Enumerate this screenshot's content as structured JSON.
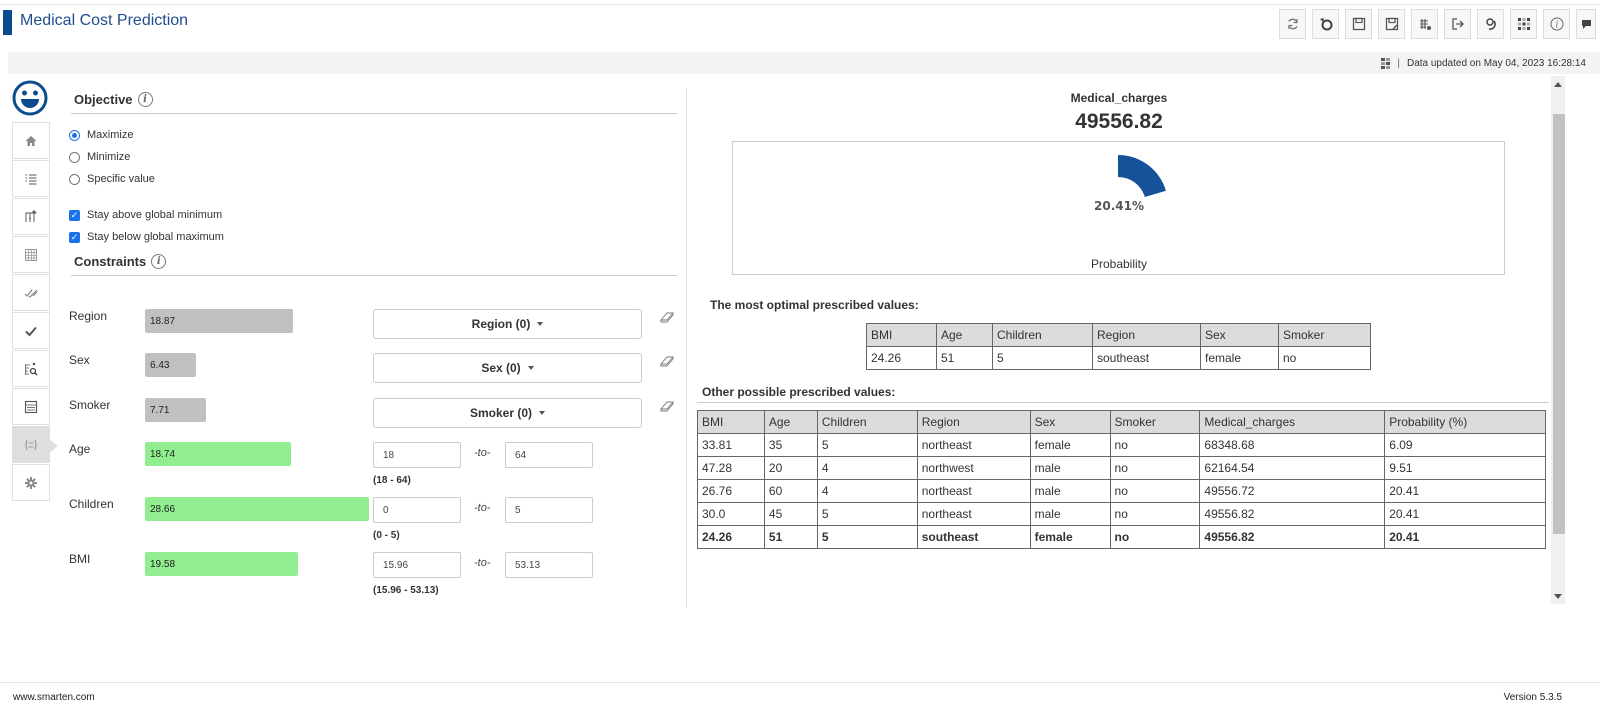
{
  "app": {
    "title": "Medical Cost Prediction"
  },
  "toolbar": {
    "buttons": [
      {
        "name": "refresh",
        "icon": "refresh-icon"
      },
      {
        "name": "reset",
        "icon": "reset-icon"
      },
      {
        "name": "save",
        "icon": "save-icon"
      },
      {
        "name": "save-as",
        "icon": "save-as-icon"
      },
      {
        "name": "data-settings",
        "icon": "data-settings-icon"
      },
      {
        "name": "export",
        "icon": "export-icon"
      },
      {
        "name": "auto-refresh",
        "icon": "auto-refresh-icon"
      },
      {
        "name": "layout",
        "icon": "grid-icon"
      },
      {
        "name": "info",
        "icon": "info-icon"
      },
      {
        "name": "comments",
        "icon": "comments-icon"
      }
    ]
  },
  "info_strip": {
    "separator": "|",
    "updated_text": "Data updated on May 04, 2023 16:28:14"
  },
  "sidebar": {
    "items": [
      {
        "name": "home",
        "icon": "home-icon"
      },
      {
        "name": "list",
        "icon": "list-icon"
      },
      {
        "name": "variables",
        "icon": "variables-icon"
      },
      {
        "name": "table",
        "icon": "table-icon"
      },
      {
        "name": "double-check",
        "icon": "double-check-icon"
      },
      {
        "name": "check",
        "icon": "check-icon"
      },
      {
        "name": "search-data",
        "icon": "search-data-icon"
      },
      {
        "name": "summary",
        "icon": "summary-icon"
      },
      {
        "name": "prescriptive",
        "icon": "prescriptive-icon",
        "active": true
      },
      {
        "name": "settings",
        "icon": "gear-icon"
      }
    ]
  },
  "objective": {
    "title": "Objective",
    "info_glyph": "i",
    "options": [
      {
        "label": "Maximize",
        "selected": true
      },
      {
        "label": "Minimize",
        "selected": false
      },
      {
        "label": "Specific value",
        "selected": false
      }
    ],
    "checks": [
      {
        "label": "Stay above global minimum",
        "checked": true
      },
      {
        "label": "Stay below global maximum",
        "checked": true
      }
    ]
  },
  "constraints": {
    "title": "Constraints",
    "info_glyph": "i",
    "categorical": [
      {
        "label": "Region",
        "importance": "18.87",
        "dropdown": "Region (0)"
      },
      {
        "label": "Sex",
        "importance": "6.43",
        "dropdown": "Sex (0)"
      },
      {
        "label": "Smoker",
        "importance": "7.71",
        "dropdown": "Smoker (0)"
      }
    ],
    "numeric": [
      {
        "label": "Age",
        "importance": "18.74",
        "from": "18",
        "to": "64",
        "range": "(18 - 64)"
      },
      {
        "label": "Children",
        "importance": "28.66",
        "from": "0",
        "to": "5",
        "range": "(0 - 5)"
      },
      {
        "label": "BMI",
        "importance": "19.58",
        "from": "15.96",
        "to": "53.13",
        "range": "(15.96 - 53.13)"
      }
    ],
    "to_label": "-to-"
  },
  "result": {
    "label": "Medical_charges",
    "value": "49556.82",
    "gauge": {
      "percent": 20.41,
      "percent_text": "20.41%",
      "caption": "Probability",
      "color": "#15529a"
    }
  },
  "optimal": {
    "title": "The most optimal prescribed values:",
    "headers": [
      "BMI",
      "Age",
      "Children",
      "Region",
      "Sex",
      "Smoker"
    ],
    "row": [
      "24.26",
      "51",
      "5",
      "southeast",
      "female",
      "no"
    ]
  },
  "other": {
    "title": "Other possible prescribed values:",
    "headers": [
      "BMI",
      "Age",
      "Children",
      "Region",
      "Sex",
      "Smoker",
      "Medical_charges",
      "Probability (%)"
    ],
    "rows": [
      [
        "33.81",
        "35",
        "5",
        "northeast",
        "female",
        "no",
        "68348.68",
        "6.09"
      ],
      [
        "47.28",
        "20",
        "4",
        "northwest",
        "male",
        "no",
        "62164.54",
        "9.51"
      ],
      [
        "26.76",
        "60",
        "4",
        "northeast",
        "male",
        "no",
        "49556.72",
        "20.41"
      ],
      [
        "30.0",
        "45",
        "5",
        "northeast",
        "male",
        "no",
        "49556.82",
        "20.41"
      ],
      [
        "24.26",
        "51",
        "5",
        "southeast",
        "female",
        "no",
        "49556.82",
        "20.41"
      ]
    ],
    "bold_row_index": 4
  },
  "footer": {
    "left": "www.smarten.com",
    "right": "Version 5.3.5"
  }
}
